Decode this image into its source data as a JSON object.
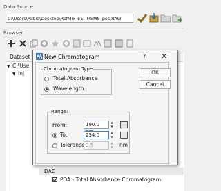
{
  "data_source": {
    "label": "Data Source",
    "path": "C:\\Users\\Pablo\\Desktop\\RefMix_ESI_MSMS_pos.RAW",
    "icons": [
      "checkmark-icon",
      "import-icon",
      "folder-icon",
      "add-folder-icon"
    ]
  },
  "browser": {
    "label": "Browser",
    "toolbar_icons": [
      "add-icon",
      "delete-icon",
      "copy-icon",
      "settings-icon",
      "star-icon",
      "sync-icon",
      "dataset-icon",
      "image-icon",
      "spectrum-icon",
      "table-icon",
      "chart-icon",
      "duplicate-icon"
    ],
    "column_dataset": "Dataset",
    "tree": [
      {
        "text": "C:\\Use",
        "indent": 0
      },
      {
        "text": "Inj",
        "indent": 1
      }
    ]
  },
  "dialog": {
    "title": "New Chromatogram",
    "help": "?",
    "close": "✕",
    "chromatogram_type": {
      "title": "Chromatogram Type",
      "options": [
        {
          "label": "Total Absorbance",
          "selected": false
        },
        {
          "label": "Wavelength",
          "selected": true
        }
      ]
    },
    "range": {
      "title": "Range:",
      "from_label": "From:",
      "from_value": "190.0 nm",
      "to_label": "To:",
      "to_value": "254.0 nm",
      "to_selected": true,
      "tolerance_label": "Tolerance:",
      "tolerance_value": "0.5",
      "tolerance_selected": false,
      "unit": "nm"
    },
    "ok": "OK",
    "cancel": "Cancel"
  },
  "bottom_tree": {
    "dad": "DAD",
    "pda": "PDA - Total Absorbance Chromatogram",
    "pda_checked": true
  }
}
